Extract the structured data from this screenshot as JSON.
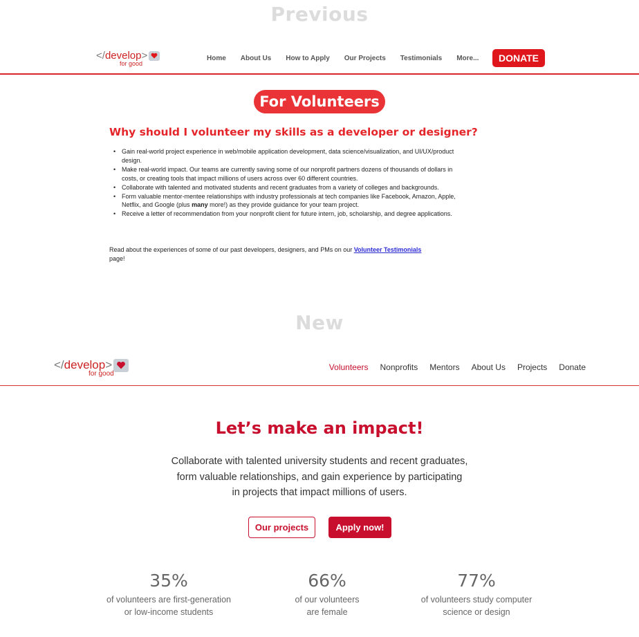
{
  "sections": {
    "previous": "Previous",
    "new": "New"
  },
  "logo": {
    "bracket_open": "</",
    "word": "develop",
    "bracket_close": ">",
    "sub": "for good",
    "icon": "heart-icon"
  },
  "old_site": {
    "nav": [
      "Home",
      "About Us",
      "How to Apply",
      "Our Projects",
      "Testimonials",
      "More..."
    ],
    "donate": "DONATE",
    "pill": "For Volunteers",
    "heading": "Why should I volunteer my skills as a developer or designer?",
    "bullets": [
      "Gain real-world project experience in web/mobile application development, data science/visualization, and UI/UX/product design.",
      "Make real-world impact. Our teams are currently saving some of our nonprofit partners dozens of thousands of dollars in costs, or creating tools that impact millions of users across over 60 different countries.",
      "Collaborate with talented and motivated students and recent graduates from a variety of colleges and backgrounds.",
      "Receive a letter of recommendation from your nonprofit client for future intern, job, scholarship, and degree applications."
    ],
    "bullet4": {
      "before": "Form valuable mentor-mentee relationships with industry professionals at tech companies like Facebook, Amazon, Apple, Netflix, and Google (plus ",
      "bold": "many",
      "after": " more!) as they provide guidance for your team project."
    },
    "read": {
      "before": "Read about the experiences of some of our past developers, designers, and PMs on our ",
      "link": "Volunteer Testimonials",
      "after": " page!"
    }
  },
  "new_site": {
    "nav": [
      "Volunteers",
      "Nonprofits",
      "Mentors",
      "About Us",
      "Projects",
      "Donate"
    ],
    "active_nav": "Volunteers",
    "title": "Let’s make an impact!",
    "intro": [
      "Collaborate with talented university students and recent graduates,",
      "form valuable relationships, and gain experience by participating",
      "in projects that impact millions of users."
    ],
    "btn_projects": "Our projects",
    "btn_apply": "Apply now!",
    "stats": [
      {
        "value": "35%",
        "line1": "of volunteers are first-generation",
        "line2": "or low-income students"
      },
      {
        "value": "66%",
        "line1": "of our volunteers",
        "line2": "are female"
      },
      {
        "value": "77%",
        "line1": "of volunteers study computer",
        "line2": "science or design"
      }
    ]
  },
  "colors": {
    "old_red": "#e0161d",
    "new_red": "#c8102e",
    "logo_gray": "#7a7a7a",
    "section_label": "#dcdcdc"
  }
}
